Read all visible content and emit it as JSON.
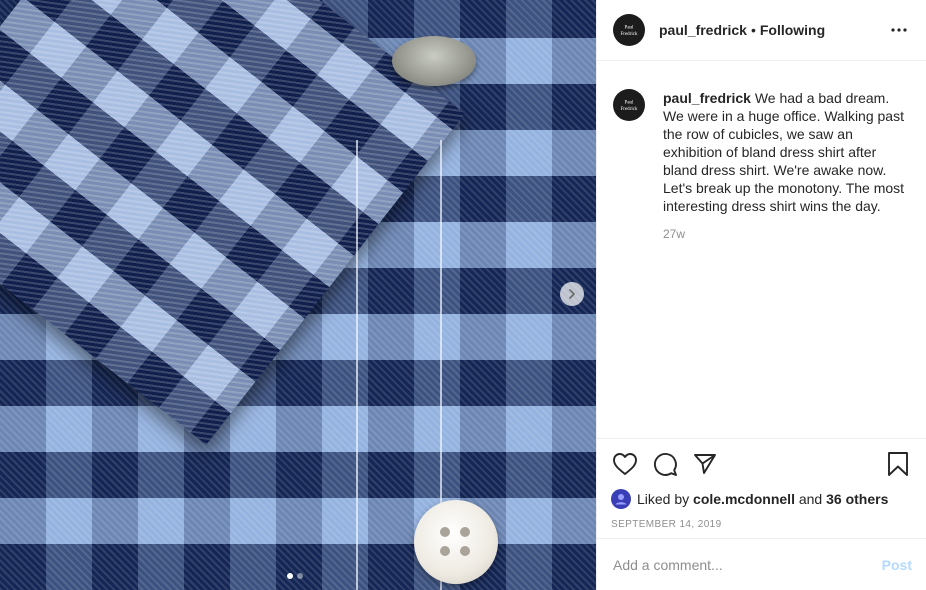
{
  "post": {
    "username": "paul_fredrick",
    "separator": "•",
    "follow_status": "Following",
    "avatar_text": "Paul Fredrick"
  },
  "caption": {
    "username": "paul_fredrick",
    "text": "We had a bad dream. We were in a huge office. Walking past the row of cubicles, we saw an exhibition of bland dress shirt after bland dress shirt. We're awake now. Let's break up the monotony. The most interesting dress shirt wins the day.",
    "time_ago": "27w"
  },
  "engagement": {
    "liked_by_prefix": "Liked by",
    "liked_by_user": "cole.mcdonnell",
    "and_text": "and",
    "others_text": "36 others",
    "date": "SEPTEMBER 14, 2019"
  },
  "comment": {
    "placeholder": "Add a comment...",
    "post_label": "Post"
  },
  "carousel": {
    "slide_count": 2,
    "active_slide": 1
  },
  "icons": {
    "more": "more-options-icon",
    "like": "heart-icon",
    "comment": "comment-icon",
    "share": "share-icon",
    "save": "bookmark-icon",
    "next": "chevron-right-icon"
  },
  "colors": {
    "post_button": "#b3dbff",
    "muted_text": "#8e8e8e",
    "text": "#262626",
    "divider": "#efefef"
  }
}
